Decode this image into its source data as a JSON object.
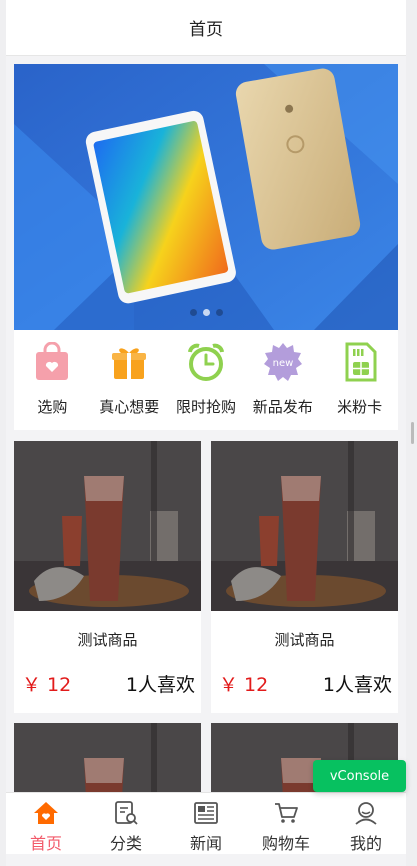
{
  "header": {
    "title": "首页"
  },
  "banner": {
    "slide_count": 3,
    "active_slide": 1
  },
  "quicknav": [
    {
      "label": "选购",
      "icon": "shopping-bag-icon",
      "color": "#f5a0ab"
    },
    {
      "label": "真心想要",
      "icon": "gift-icon",
      "color": "#f8a21d"
    },
    {
      "label": "限时抢购",
      "icon": "alarm-clock-icon",
      "color": "#8fd14f"
    },
    {
      "label": "新品发布",
      "icon": "new-badge-icon",
      "color": "#b39ddb"
    },
    {
      "label": "米粉卡",
      "icon": "sim-card-icon",
      "color": "#8fd14f"
    }
  ],
  "goods": [
    {
      "title": "测试商品",
      "price": "￥ 12",
      "likes": "1人喜欢"
    },
    {
      "title": "测试商品",
      "price": "￥ 12",
      "likes": "1人喜欢"
    },
    {
      "title": "",
      "price": "",
      "likes": ""
    },
    {
      "title": "",
      "price": "",
      "likes": ""
    }
  ],
  "vconsole": {
    "label": "vConsole"
  },
  "tabbar": [
    {
      "label": "首页",
      "icon": "home-icon",
      "active": true
    },
    {
      "label": "分类",
      "icon": "category-search-icon",
      "active": false
    },
    {
      "label": "新闻",
      "icon": "newspaper-icon",
      "active": false
    },
    {
      "label": "购物车",
      "icon": "cart-icon",
      "active": false
    },
    {
      "label": "我的",
      "icon": "user-icon",
      "active": false
    }
  ],
  "colors": {
    "accent": "#f25a6a",
    "price": "#e21b1b",
    "vconsole": "#07c160",
    "home_icon": "#ff6a00"
  }
}
